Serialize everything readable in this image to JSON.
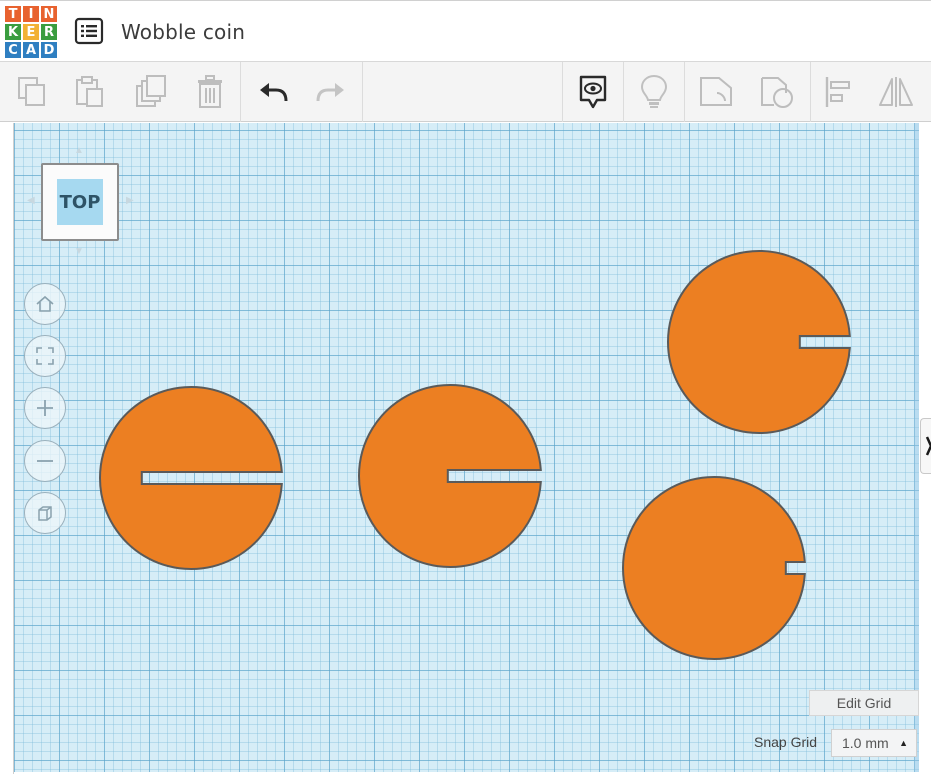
{
  "app": {
    "logo_letters": [
      "T",
      "I",
      "N",
      "K",
      "E",
      "R",
      "C",
      "A",
      "D"
    ],
    "logo_colors": [
      "#e8622f",
      "#e8622f",
      "#e8622f",
      "#3a9d3f",
      "#f2b134",
      "#3a9d3f",
      "#2f7fc1",
      "#2f7fc1",
      "#2f7fc1"
    ],
    "title": "Wobble coin"
  },
  "toolbar": {
    "buttons": [
      "copy-icon",
      "paste-icon",
      "duplicate-icon",
      "delete-icon",
      "undo-icon",
      "redo-icon",
      "notes-icon",
      "light-bulb-icon",
      "shape-solid-icon",
      "shape-hole-icon",
      "align-icon",
      "mirror-icon"
    ]
  },
  "viewcube": {
    "label": "TOP"
  },
  "nav": {
    "buttons": [
      "home-icon",
      "fit-view-icon",
      "zoom-in-icon",
      "zoom-out-icon",
      "perspective-icon"
    ]
  },
  "workplane": {
    "edit_grid_label": "Edit Grid",
    "snap_grid_label": "Snap Grid",
    "snap_grid_value": "1.0 mm"
  },
  "colors": {
    "shape_fill": "#ec7f22",
    "shape_stroke": "#5a5a5a",
    "grid_bg": "#d6edf7",
    "icon_gray": "#b9b9b9"
  }
}
